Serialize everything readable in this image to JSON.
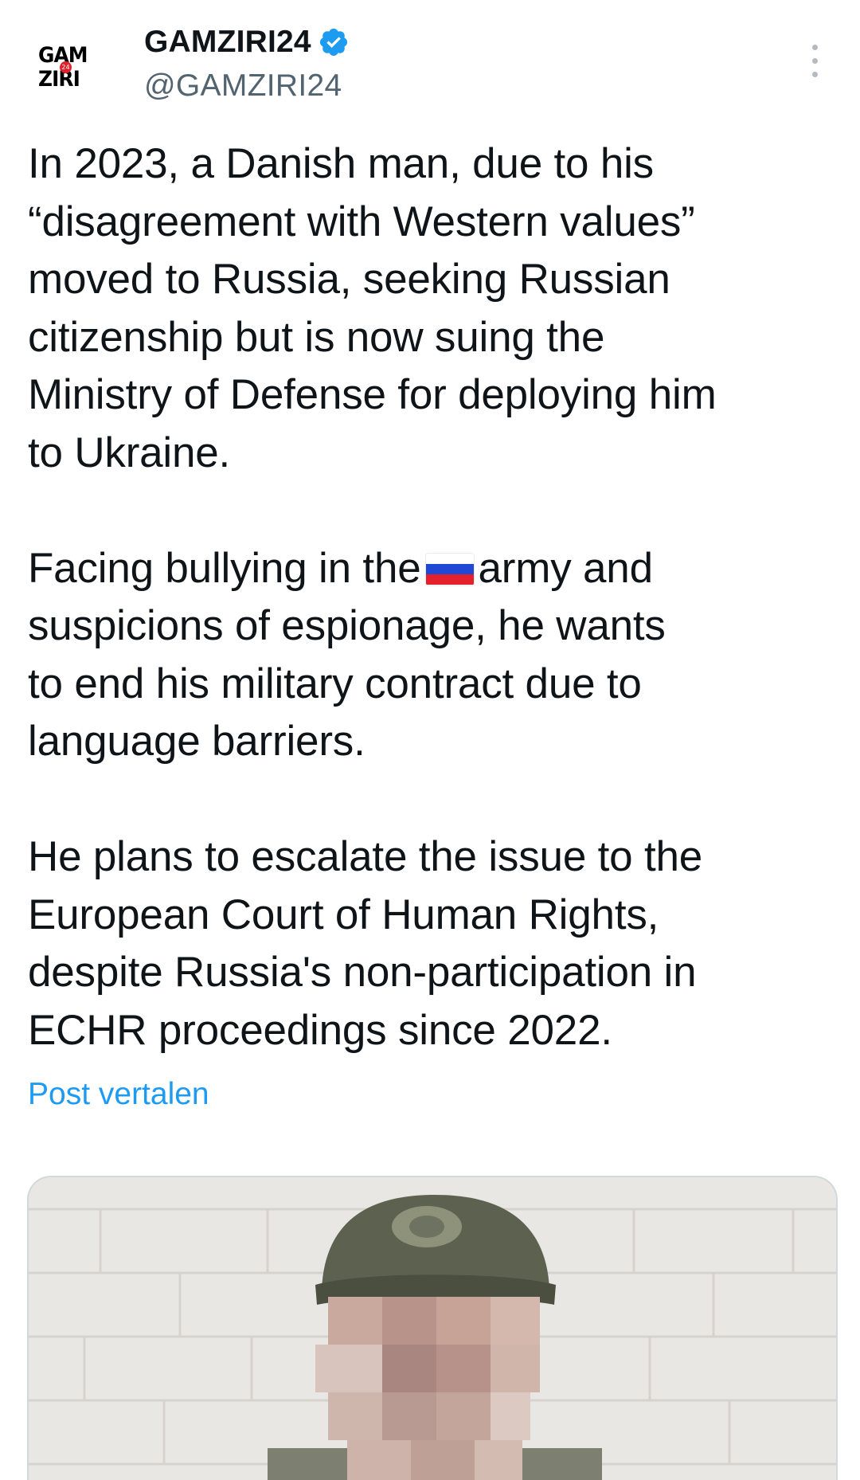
{
  "author": {
    "display_name": "GAMZIRI24",
    "handle": "@GAMZIRI24",
    "verified": true,
    "avatar": {
      "logo_line1": "GAM",
      "logo_line2": "ZIRI",
      "badge": "24"
    }
  },
  "post": {
    "paragraphs": [
      {
        "lines": [
          "In 2023, a Danish man, due to his",
          "“disagreement with Western values”",
          "moved to Russia, seeking Russian",
          "citizenship but is now suing the",
          "Ministry of Defense for deploying him",
          "to Ukraine."
        ]
      },
      {
        "line1_before": "Facing bullying in the",
        "line1_after": "army and",
        "flag_icon": "russia-flag-icon",
        "lines": [
          "suspicions of espionage, he wants",
          "to end his military contract due to",
          "language barriers."
        ]
      },
      {
        "lines": [
          "He plans to escalate the issue to the",
          "European Court of Human Rights,",
          "despite Russia's non-participation in",
          "ECHR proceedings since 2022."
        ]
      }
    ],
    "translate_label": "Post vertalen"
  },
  "media": {
    "description_icon": "soldier-photo",
    "colors": {
      "wall": "#e9e7e3",
      "cap": "#5d6250",
      "blur": "#c9a89e"
    }
  },
  "colors": {
    "text": "#0f1419",
    "secondary": "#536471",
    "link": "#1d9bf0",
    "verified": "#1d9bf0"
  },
  "icons": {
    "more": "more-vertical-icon",
    "verified": "verified-badge-icon"
  }
}
